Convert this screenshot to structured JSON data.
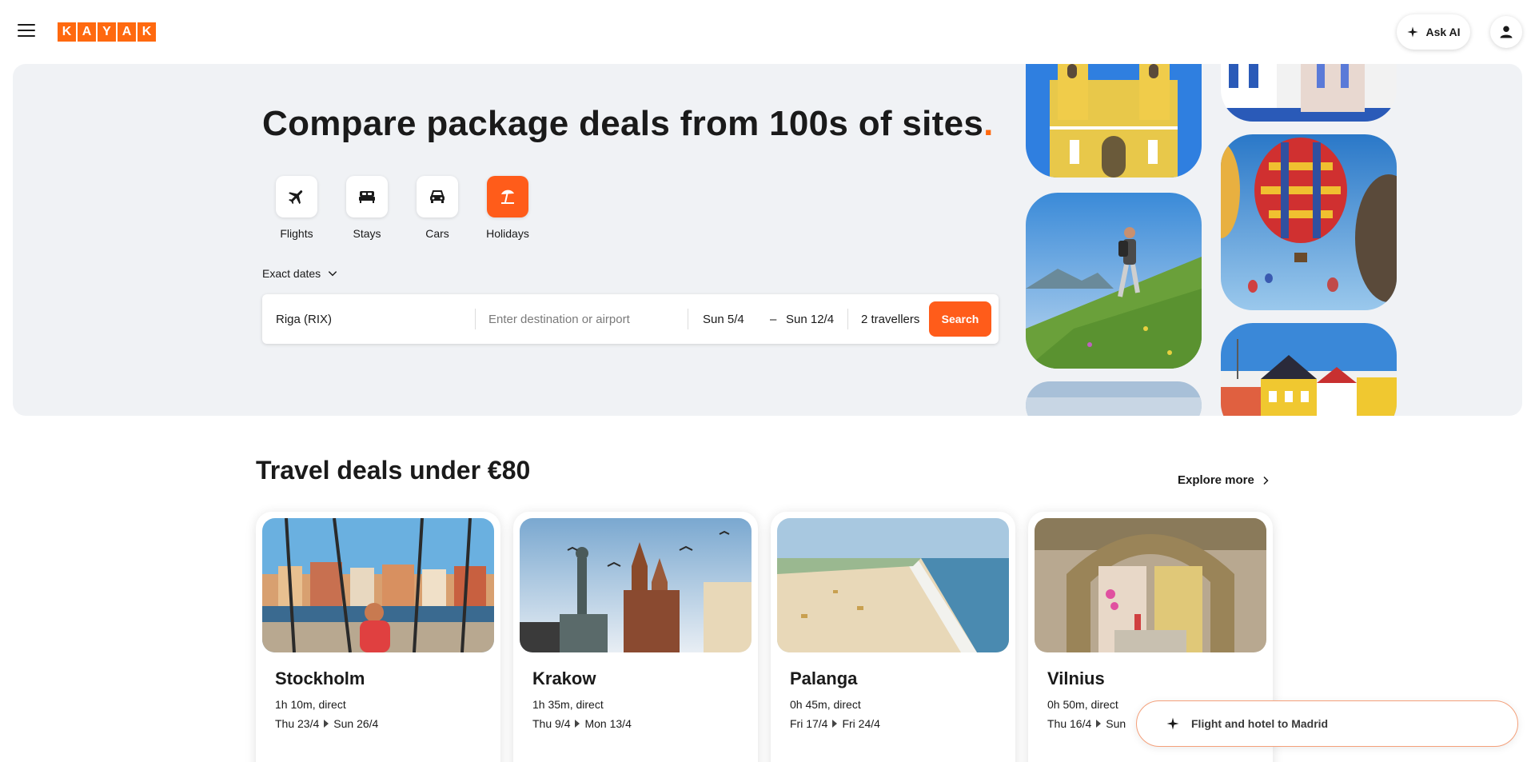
{
  "header": {
    "logo_letters": [
      "K",
      "A",
      "Y",
      "A",
      "K"
    ],
    "ask_ai_label": "Ask AI",
    "brand_color": "#ff690f"
  },
  "hero": {
    "title": "Compare package deals from 100s of sites",
    "title_dot": ".",
    "verticals": [
      {
        "label": "Flights",
        "icon": "plane-icon"
      },
      {
        "label": "Stays",
        "icon": "bed-icon"
      },
      {
        "label": "Cars",
        "icon": "car-icon"
      },
      {
        "label": "Holidays",
        "icon": "beach-umbrella-icon",
        "active": true
      }
    ],
    "date_mode": "Exact dates",
    "search": {
      "origin": "Riga (RIX)",
      "destination_placeholder": "Enter destination or airport",
      "depart_date": "Sun 5/4",
      "date_separator": "–",
      "return_date": "Sun 12/4",
      "travellers": "2 travellers",
      "button_label": "Search"
    }
  },
  "deals": {
    "title": "Travel deals under €80",
    "explore_label": "Explore more",
    "cards": [
      {
        "city": "Stockholm",
        "duration": "1h 10m, direct",
        "depart": "Thu 23/4",
        "return": "Sun 26/4"
      },
      {
        "city": "Krakow",
        "duration": "1h 35m, direct",
        "depart": "Thu 9/4",
        "return": "Mon 13/4"
      },
      {
        "city": "Palanga",
        "duration": "0h 45m, direct",
        "depart": "Fri 17/4",
        "return": "Fri 24/4"
      },
      {
        "city": "Vilnius",
        "duration": "0h 50m, direct",
        "depart": "Thu 16/4",
        "return": "Sun"
      }
    ]
  },
  "ai_prompt": {
    "text": "Flight and hotel to Madrid"
  }
}
